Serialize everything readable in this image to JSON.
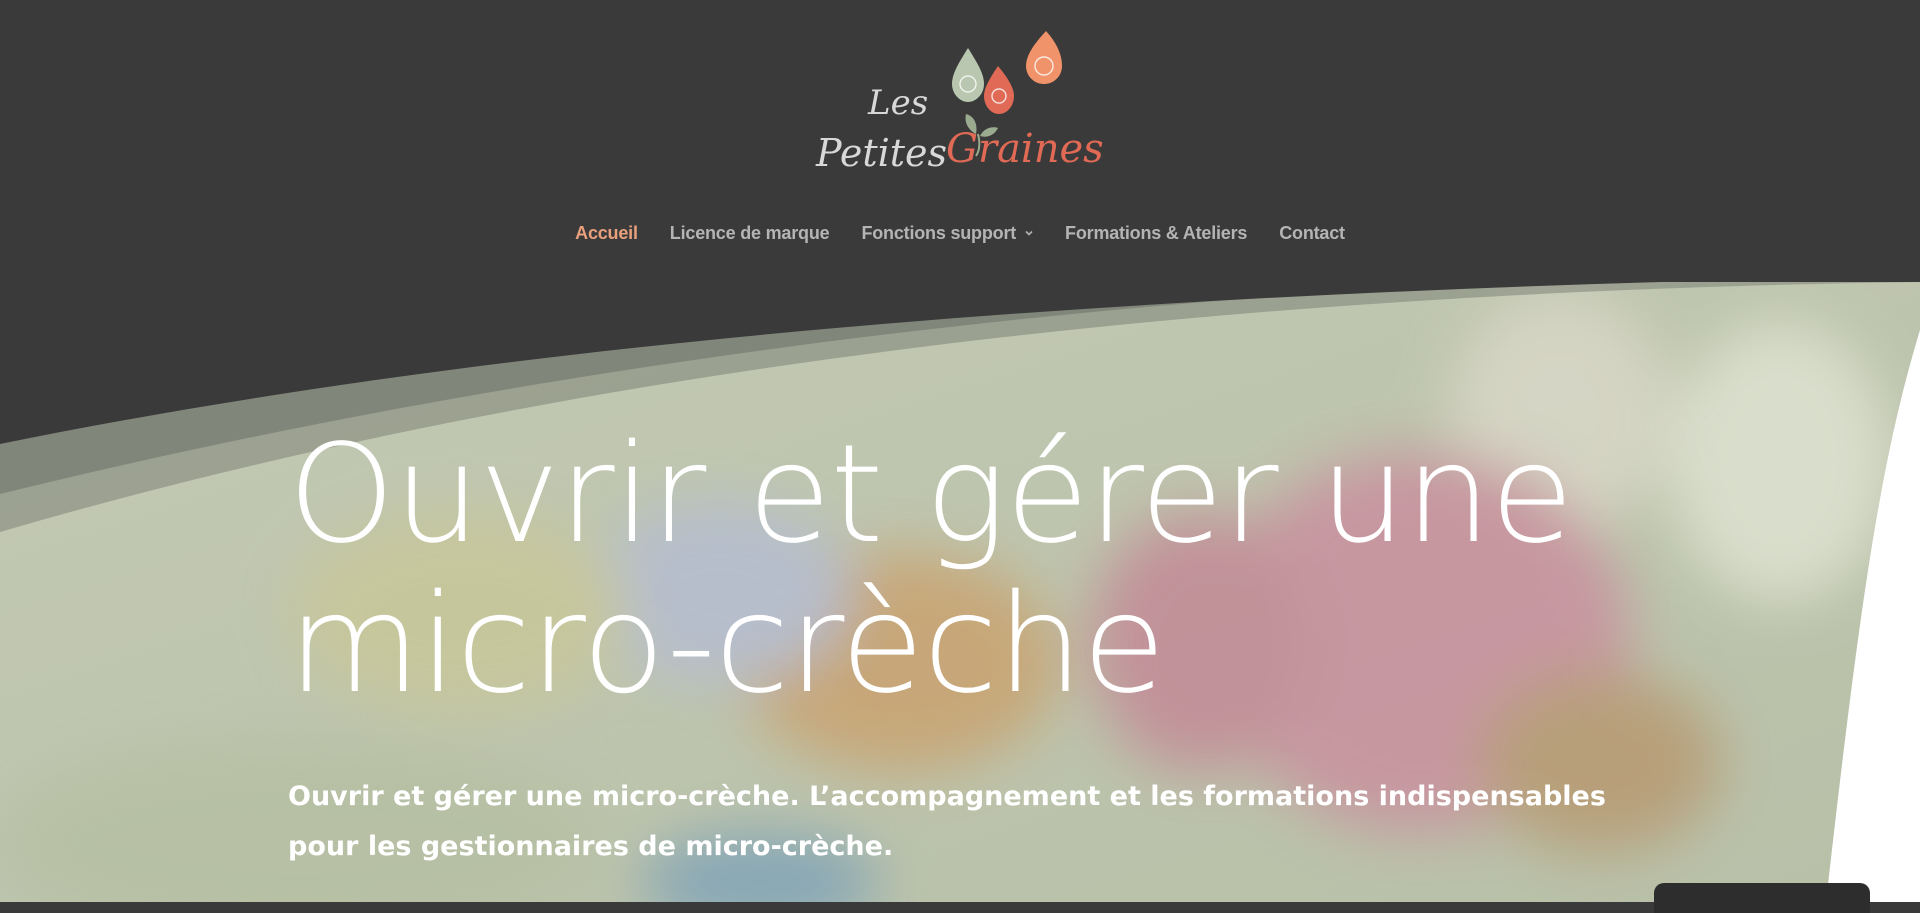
{
  "logo": {
    "line1": "Les",
    "line2": "Petites",
    "line3": "Graines",
    "colors": {
      "green": "#b9c7b0",
      "red": "#e06a55",
      "peach": "#f0936a",
      "leaf": "#9aab8f"
    }
  },
  "nav": {
    "items": [
      {
        "label": "Accueil",
        "active": true
      },
      {
        "label": "Licence de marque",
        "active": false
      },
      {
        "label": "Fonctions support",
        "active": false,
        "icon": "chevron-down-icon"
      },
      {
        "label": "Formations & Ateliers",
        "active": false
      },
      {
        "label": "Contact",
        "active": false
      }
    ],
    "active_color": "#e8a07d",
    "color": "#b4b4b4"
  },
  "hero": {
    "title": "Ouvrir et gérer une micro-crèche",
    "subtitle": "Ouvrir et gérer une micro-crèche. L’accompagnement et les formations indispensables pour les gestionnaires de micro-crèche."
  },
  "colors": {
    "header_bg": "#3a3a3a",
    "overlay": "#c9d0bc"
  }
}
